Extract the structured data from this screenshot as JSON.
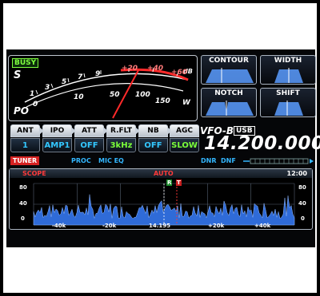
{
  "meter": {
    "busy": "BUSY",
    "s_label": "S",
    "po_label": "PO",
    "s_scale": [
      "1",
      "3",
      "5",
      "7",
      "9",
      "+20",
      "+40",
      "+60"
    ],
    "s_unit": "dB",
    "po_scale": [
      "0",
      "10",
      "50",
      "100",
      "150"
    ],
    "po_unit": "W"
  },
  "dsp": {
    "contour": "CONTOUR",
    "width": "WIDTH",
    "notch": "NOTCH",
    "shift": "SHIFT"
  },
  "keys": [
    {
      "label": "ANT",
      "value": "1"
    },
    {
      "label": "IPO",
      "value": "AMP1"
    },
    {
      "label": "ATT",
      "value": "OFF"
    },
    {
      "label": "R.FLT",
      "value": "3kHz"
    },
    {
      "label": "NB",
      "value": "OFF"
    },
    {
      "label": "AGC",
      "value": "SLOW"
    }
  ],
  "vfo": {
    "label": "VFO-B",
    "mode": "USB",
    "frequency": "14.200.000"
  },
  "status": {
    "tuner": "TUNER",
    "proc": "PROC",
    "mic_eq": "MIC EQ",
    "dnr": "DNR",
    "dnf": "DNF"
  },
  "scope": {
    "title": "SCOPE",
    "mode": "AUTO",
    "time": "12:00",
    "y_left": [
      "80",
      "40",
      "0"
    ],
    "y_right": [
      "80",
      "40",
      "0"
    ],
    "x_labels": [
      "-40k",
      "-20k",
      "14.195",
      "+20k",
      "+40k"
    ],
    "markers": [
      "R",
      "T"
    ]
  },
  "colors": {
    "spectrum": "#2f6bd8",
    "needle": "#ff2a2a",
    "accent_blue": "#33c7ff",
    "busy_green": "#7fff3f"
  }
}
